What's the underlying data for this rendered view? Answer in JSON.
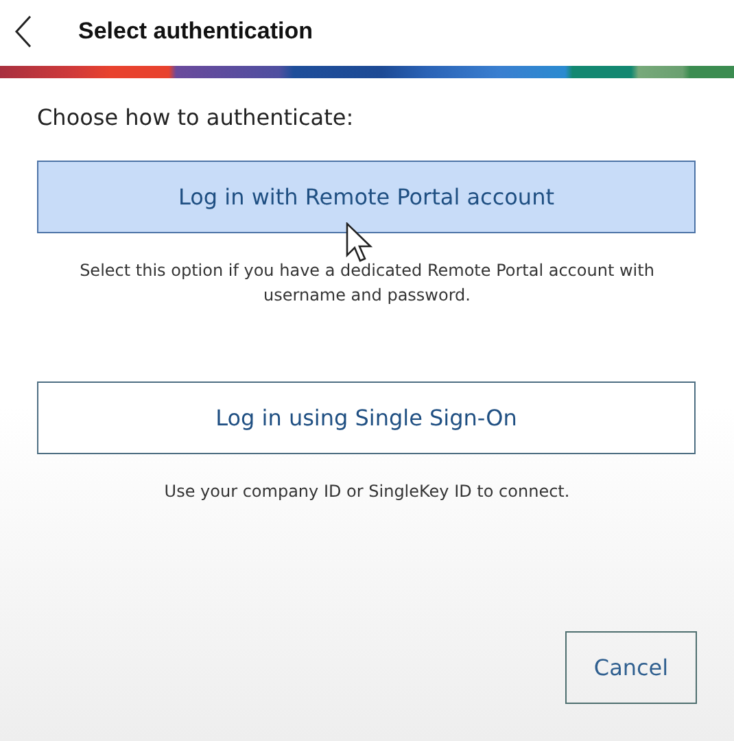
{
  "header": {
    "title": "Select authentication"
  },
  "prompt": "Choose how to authenticate:",
  "options": [
    {
      "label": "Log in with Remote Portal account",
      "selected": true,
      "description": "Select this option if you have a dedicated Remote Portal account with username and password."
    },
    {
      "label": "Log in using Single Sign-On",
      "selected": false,
      "description": "Use your company ID or SingleKey ID to connect."
    }
  ],
  "buttons": [
    "Cancel"
  ]
}
